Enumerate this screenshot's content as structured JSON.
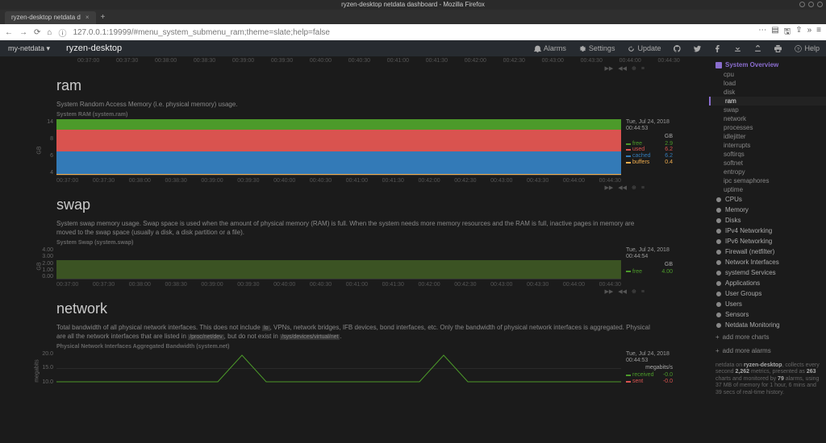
{
  "window": {
    "title": "ryzen-desktop netdata dashboard - Mozilla Firefox"
  },
  "browser": {
    "tab_title": "ryzen-desktop netdata d",
    "url": "127.0.0.1:19999/#menu_system_submenu_ram;theme=slate;help=false"
  },
  "app": {
    "brand": "my-netdata ▾",
    "host": "ryzen-desktop",
    "nav": {
      "alarms": "Alarms",
      "settings": "Settings",
      "update": "Update",
      "help": "Help"
    }
  },
  "ruler": [
    "00:37:00",
    "00:37:30",
    "00:38:00",
    "00:38:30",
    "00:39:00",
    "00:39:30",
    "00:40:00",
    "00:40:30",
    "00:41:00",
    "00:41:30",
    "00:42:00",
    "00:42:30",
    "00:43:00",
    "00:43:30",
    "00:44:00",
    "00:44:30"
  ],
  "sections": {
    "ram": {
      "title": "ram",
      "desc": "System Random Access Memory (i.e. physical memory) usage.",
      "chart_title": "System RAM (system.ram)",
      "yticks": [
        "14",
        "8",
        "6",
        "4"
      ],
      "timestamp_line1": "Tue, Jul 24, 2018",
      "timestamp_line2": "00:44:53",
      "unit": "GB",
      "legend": [
        {
          "name": "free",
          "color": "#4c9a2a",
          "value": "2.9"
        },
        {
          "name": "used",
          "color": "#d9534f",
          "value": "6.2"
        },
        {
          "name": "cached",
          "color": "#337ab7",
          "value": "6.2"
        },
        {
          "name": "buffers",
          "color": "#f0ad4e",
          "value": "0.4"
        }
      ]
    },
    "swap": {
      "title": "swap",
      "desc": "System swap memory usage. Swap space is used when the amount of physical memory (RAM) is full. When the system needs more memory resources and the RAM is full, inactive pages in memory are moved to the swap space (usually a disk, a disk partition or a file).",
      "chart_title": "System Swap (system.swap)",
      "yticks": [
        "4.00",
        "3.00",
        "2.00",
        "1.00",
        "0.00"
      ],
      "timestamp_line1": "Tue, Jul 24, 2018",
      "timestamp_line2": "00:44:54",
      "unit": "GB",
      "legend": [
        {
          "name": "free",
          "color": "#4c9a2a",
          "value": "4.00"
        }
      ]
    },
    "network": {
      "title": "network",
      "desc_pre": "Total bandwidth of all physical network interfaces. This does not include ",
      "desc_code1": "lo",
      "desc_mid": ", VPNs, network bridges, IFB devices, bond interfaces, etc. Only the bandwidth of physical network interfaces is aggregated. Physical are all the network interfaces that are listed in ",
      "desc_code2": "/proc/net/dev",
      "desc_mid2": ", but do not exist in ",
      "desc_code3": "/sys/devices/virtual/net",
      "chart_title": "Physical Network Interfaces Aggregated Bandwidth (system.net)",
      "yticks": [
        "20.0",
        "15.0",
        "10.0"
      ],
      "timestamp_line1": "Tue, Jul 24, 2018",
      "timestamp_line2": "00:44:53",
      "unit": "megabits/s",
      "legend": [
        {
          "name": "received",
          "color": "#4c9a2a",
          "value": "-0.0"
        },
        {
          "name": "sent",
          "color": "#d9534f",
          "value": "-0.0"
        }
      ]
    }
  },
  "xaxis": [
    "00:37:00",
    "00:37:30",
    "00:38:00",
    "00:38:30",
    "00:39:00",
    "00:39:30",
    "00:40:00",
    "00:40:30",
    "00:41:00",
    "00:41:30",
    "00:42:00",
    "00:42:30",
    "00:43:00",
    "00:43:30",
    "00:44:00",
    "00:44:30"
  ],
  "sidebar": {
    "header": "System Overview",
    "items": [
      "cpu",
      "load",
      "disk",
      "ram",
      "swap",
      "network",
      "processes",
      "idlejitter",
      "interrupts",
      "softirqs",
      "softnet",
      "entropy",
      "ipc semaphores",
      "uptime"
    ],
    "active": "ram",
    "sections": [
      "CPUs",
      "Memory",
      "Disks",
      "IPv4 Networking",
      "IPv6 Networking",
      "Firewall (netfilter)",
      "Network Interfaces",
      "systemd Services",
      "Applications",
      "User Groups",
      "Users",
      "Sensors",
      "Netdata Monitoring"
    ],
    "add_charts": "add more charts",
    "add_alarms": "add more alarms",
    "footer": {
      "host": "ryzen-desktop",
      "metrics": "2,262",
      "charts": "263",
      "alarms": "79",
      "mem": "37 MB",
      "dur": "1 hour, 6 mins and 39 secs"
    }
  },
  "chart_data": [
    {
      "type": "area",
      "title": "System RAM",
      "x_range": [
        "00:37:00",
        "00:44:53"
      ],
      "ylabel": "GB",
      "ylim": [
        0,
        16
      ],
      "series": [
        {
          "name": "free",
          "value": 2.9,
          "color": "#4c9a2a"
        },
        {
          "name": "used",
          "value": 6.2,
          "color": "#d9534f"
        },
        {
          "name": "cached",
          "value": 6.2,
          "color": "#337ab7"
        },
        {
          "name": "buffers",
          "value": 0.4,
          "color": "#f0ad4e"
        }
      ]
    },
    {
      "type": "area",
      "title": "System Swap",
      "x_range": [
        "00:37:00",
        "00:44:54"
      ],
      "ylabel": "GB",
      "ylim": [
        0,
        4
      ],
      "series": [
        {
          "name": "free",
          "value": 4.0,
          "color": "#4c9a2a"
        }
      ]
    },
    {
      "type": "line",
      "title": "Physical Network Interfaces Aggregated Bandwidth",
      "x_range": [
        "00:37:00",
        "00:44:53"
      ],
      "ylabel": "megabits/s",
      "ylim": [
        0,
        20
      ],
      "series": [
        {
          "name": "received",
          "value": 0.0,
          "color": "#4c9a2a"
        },
        {
          "name": "sent",
          "value": 0.0,
          "color": "#d9534f"
        }
      ]
    }
  ]
}
